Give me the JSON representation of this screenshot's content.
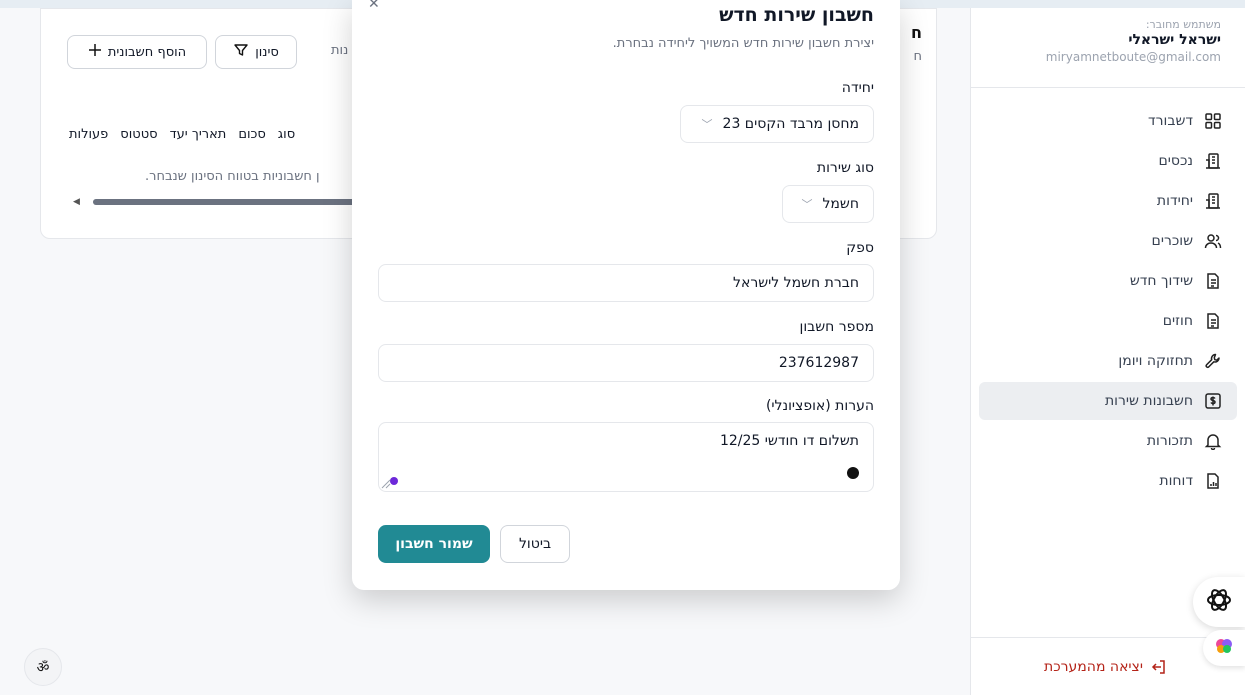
{
  "sidebar": {
    "user_caption": "משתמש מחובר:",
    "user_name": "ישראל ישראלי",
    "user_email": "miryamnetboute@gmail.com",
    "items": [
      {
        "label": "דשבורד",
        "icon": "dashboard-icon"
      },
      {
        "label": "נכסים",
        "icon": "building-icon"
      },
      {
        "label": "יחידות",
        "icon": "building-icon"
      },
      {
        "label": "שוכרים",
        "icon": "users-icon"
      },
      {
        "label": "שידוך חדש",
        "icon": "document-icon"
      },
      {
        "label": "חוזים",
        "icon": "document-icon"
      },
      {
        "label": "תחזוקה ויומן",
        "icon": "wrench-icon"
      },
      {
        "label": "חשבונות שירות",
        "icon": "dollar-icon",
        "active": true
      },
      {
        "label": "תזכורות",
        "icon": "bell-icon"
      },
      {
        "label": "דוחות",
        "icon": "report-icon"
      }
    ],
    "logout_label": "יציאה מהמערכת"
  },
  "background": {
    "title_fragment": "ח",
    "sub_fragment": "ח",
    "add_button_label": "הוסף חשבונית",
    "filter_button_label": "סינון",
    "tab_fragment": "נות",
    "table_headers": [
      "סוג",
      "סכום",
      "תאריך יעד",
      "סטטוס",
      "פעולות"
    ],
    "empty_message": "ן חשבוניות בטווח הסינון שנבחר."
  },
  "modal": {
    "title": "חשבון שירות חדש",
    "subtitle": "יצירת חשבון שירות חדש המשויך ליחידה נבחרת.",
    "unit_label": "יחידה",
    "unit_value": "מחסן מרבד הקסים 23",
    "service_type_label": "סוג שירות",
    "service_type_value": "חשמל",
    "provider_label": "ספק",
    "provider_value": "חברת חשמל לישראל",
    "account_number_label": "מספר חשבון",
    "account_number_value": "237612987",
    "notes_label": "הערות (אופציונלי)",
    "notes_value": "תשלום דו חודשי 12/25",
    "cancel_label": "ביטול",
    "save_label": "שמור חשבון"
  },
  "a11y_glyph": "ॐ",
  "colors": {
    "primary": "#218a94",
    "logout": "#b42318",
    "active_nav_bg": "#eceef1"
  }
}
